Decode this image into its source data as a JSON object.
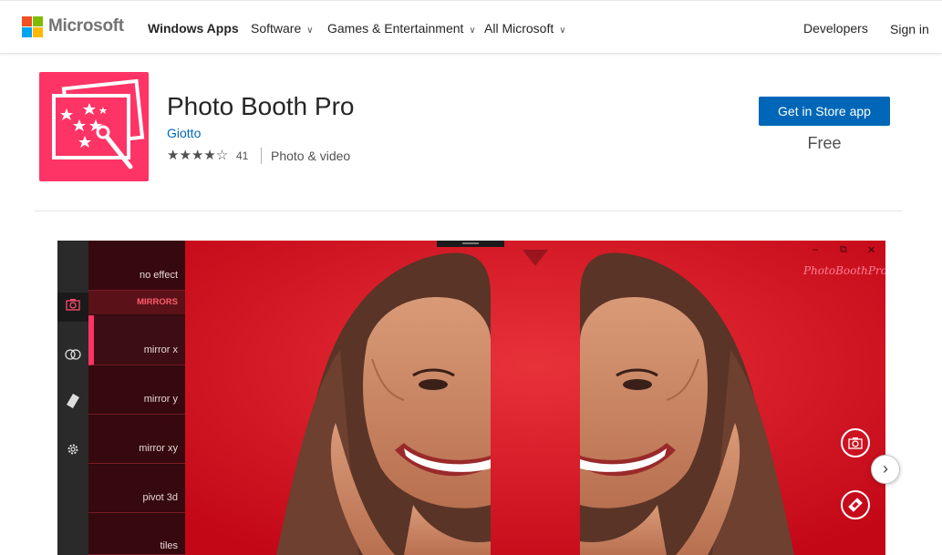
{
  "header": {
    "brand": "Microsoft",
    "nav": {
      "windows_apps": "Windows Apps",
      "software": "Software",
      "games": "Games & Entertainment",
      "all_microsoft": "All Microsoft",
      "developers": "Developers",
      "sign_in": "Sign in"
    }
  },
  "app": {
    "name": "Photo Booth Pro",
    "publisher": "Giotto",
    "rating_stars": "★★★★☆",
    "rating_count": "41",
    "category": "Photo & video",
    "cta_label": "Get in Store app",
    "price": "Free"
  },
  "screenshot": {
    "effects_panel": {
      "items": {
        "no_effect": "no effect",
        "mirror_x": "mirror x",
        "mirror_y": "mirror y",
        "mirror_xy": "mirror xy",
        "pivot_3d": "pivot 3d",
        "tiles": "tiles"
      },
      "section_header": "MIRRORS",
      "selected": "mirror x"
    },
    "watermark": "PhotoBoothPro",
    "window_controls": {
      "minimize": "–",
      "restore": "⧉",
      "close": "✕"
    }
  },
  "icons": {
    "rail": [
      "camera-icon",
      "masks-icon",
      "film-icon",
      "gear-icon"
    ],
    "right": [
      "camera-capture-icon",
      "film-strip-icon"
    ],
    "carousel": "chevron-right-icon"
  },
  "colors": {
    "accent_blue": "#0067b8",
    "app_icon_bg": "#ff3466",
    "photo_bg": "#d80d22",
    "ms_red": "#f25022",
    "ms_green": "#7fba00",
    "ms_blue": "#00a4ef",
    "ms_yellow": "#ffb900"
  }
}
